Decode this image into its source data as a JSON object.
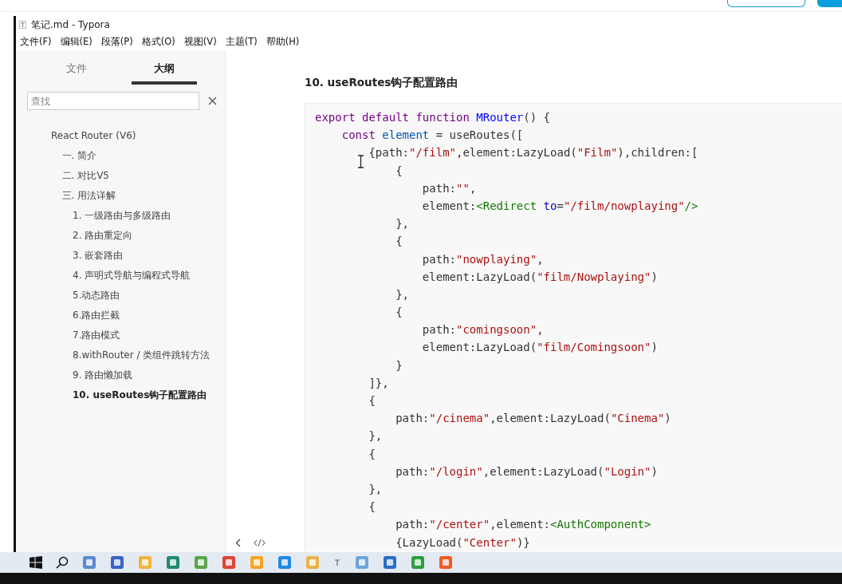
{
  "window": {
    "title": "笔记.md - Typora"
  },
  "menu": [
    "文件(F)",
    "编辑(E)",
    "段落(P)",
    "格式(O)",
    "视图(V)",
    "主题(T)",
    "帮助(H)"
  ],
  "sidebar": {
    "tabs": [
      {
        "label": "文件",
        "selected": false
      },
      {
        "label": "大纲",
        "selected": true
      }
    ],
    "search": {
      "placeholder": "查找"
    },
    "outline": [
      {
        "label": "React Router (V6)",
        "selected": false,
        "children": [
          {
            "label": "一. 简介",
            "selected": false
          },
          {
            "label": "二. 对比V5",
            "selected": false
          },
          {
            "label": "三. 用法详解",
            "selected": false,
            "children": [
              {
                "label": "1. 一级路由与多级路由",
                "selected": false
              },
              {
                "label": "2. 路由重定向",
                "selected": false
              },
              {
                "label": "3. 嵌套路由",
                "selected": false
              },
              {
                "label": "4. 声明式导航与编程式导航",
                "selected": false
              },
              {
                "label": "5.动态路由",
                "selected": false
              },
              {
                "label": "6.路由拦截",
                "selected": false
              },
              {
                "label": "7.路由模式",
                "selected": false
              },
              {
                "label": "8.withRouter / 类组件跳转方法",
                "selected": false
              },
              {
                "label": "9. 路由懒加载",
                "selected": false
              },
              {
                "label": "10. useRoutes钩子配置路由",
                "selected": true
              }
            ]
          }
        ]
      }
    ]
  },
  "document": {
    "heading": "10. useRoutes钩子配置路由",
    "code_lines": [
      [
        {
          "kind": "keyword",
          "text": "export default function "
        },
        {
          "kind": "def",
          "text": "MRouter"
        },
        {
          "kind": "plain",
          "text": "() {"
        }
      ],
      [
        {
          "kind": "keyword",
          "text": "    const "
        },
        {
          "kind": "variable",
          "text": "element"
        },
        {
          "kind": "plain",
          "text": " = useRoutes(["
        }
      ],
      [
        {
          "kind": "plain",
          "text": "        {path:"
        },
        {
          "kind": "string",
          "text": "\"/film\""
        },
        {
          "kind": "plain",
          "text": ",element:LazyLoad("
        },
        {
          "kind": "string",
          "text": "\"Film\""
        },
        {
          "kind": "plain",
          "text": "),children:["
        }
      ],
      [
        {
          "kind": "plain",
          "text": "            {"
        }
      ],
      [
        {
          "kind": "plain",
          "text": "                path:"
        },
        {
          "kind": "string",
          "text": "\"\""
        },
        {
          "kind": "plain",
          "text": ","
        }
      ],
      [
        {
          "kind": "plain",
          "text": "                element:"
        },
        {
          "kind": "tag",
          "text": "<Redirect "
        },
        {
          "kind": "attribute",
          "text": "to"
        },
        {
          "kind": "plain",
          "text": "="
        },
        {
          "kind": "string",
          "text": "\"/film/nowplaying\""
        },
        {
          "kind": "tag",
          "text": "/>"
        }
      ],
      [
        {
          "kind": "plain",
          "text": "            },"
        }
      ],
      [
        {
          "kind": "plain",
          "text": "            {"
        }
      ],
      [
        {
          "kind": "plain",
          "text": "                path:"
        },
        {
          "kind": "string",
          "text": "\"nowplaying\""
        },
        {
          "kind": "plain",
          "text": ","
        }
      ],
      [
        {
          "kind": "plain",
          "text": "                element:LazyLoad("
        },
        {
          "kind": "string",
          "text": "\"film/Nowplaying\""
        },
        {
          "kind": "plain",
          "text": ")"
        }
      ],
      [
        {
          "kind": "plain",
          "text": "            },"
        }
      ],
      [
        {
          "kind": "plain",
          "text": "            {"
        }
      ],
      [
        {
          "kind": "plain",
          "text": "                path:"
        },
        {
          "kind": "string",
          "text": "\"comingsoon\""
        },
        {
          "kind": "plain",
          "text": ","
        }
      ],
      [
        {
          "kind": "plain",
          "text": "                element:LazyLoad("
        },
        {
          "kind": "string",
          "text": "\"film/Comingsoon\""
        },
        {
          "kind": "plain",
          "text": ")"
        }
      ],
      [
        {
          "kind": "plain",
          "text": "            }"
        }
      ],
      [
        {
          "kind": "plain",
          "text": "        ]},"
        }
      ],
      [
        {
          "kind": "plain",
          "text": "        {"
        }
      ],
      [
        {
          "kind": "plain",
          "text": "            path:"
        },
        {
          "kind": "string",
          "text": "\"/cinema\""
        },
        {
          "kind": "plain",
          "text": ",element:LazyLoad("
        },
        {
          "kind": "string",
          "text": "\"Cinema\""
        },
        {
          "kind": "plain",
          "text": ")"
        }
      ],
      [
        {
          "kind": "plain",
          "text": "        },"
        }
      ],
      [
        {
          "kind": "plain",
          "text": "        {"
        }
      ],
      [
        {
          "kind": "plain",
          "text": "            path:"
        },
        {
          "kind": "string",
          "text": "\"/login\""
        },
        {
          "kind": "plain",
          "text": ",element:LazyLoad("
        },
        {
          "kind": "string",
          "text": "\"Login\""
        },
        {
          "kind": "plain",
          "text": ")"
        }
      ],
      [
        {
          "kind": "plain",
          "text": "        },"
        }
      ],
      [
        {
          "kind": "plain",
          "text": "        {"
        }
      ],
      [
        {
          "kind": "plain",
          "text": "            path:"
        },
        {
          "kind": "string",
          "text": "\"/center\""
        },
        {
          "kind": "plain",
          "text": ",element:"
        },
        {
          "kind": "tag",
          "text": "<AuthComponent>"
        }
      ],
      [
        {
          "kind": "plain",
          "text": "            {LazyLoad("
        },
        {
          "kind": "string",
          "text": "\"Center\""
        },
        {
          "kind": "plain",
          "text": ")}"
        }
      ]
    ]
  }
}
